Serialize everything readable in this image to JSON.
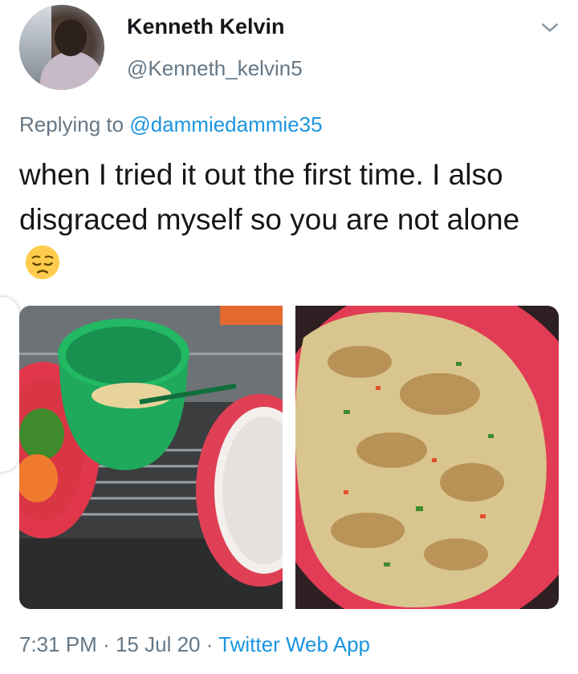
{
  "author": {
    "name": "Kenneth Kelvin",
    "handle": "@Kenneth_kelvin5"
  },
  "reply": {
    "prefix": "Replying to",
    "mention": "@dammiedammie35"
  },
  "tweet": {
    "text": "when I tried it out the first time. I also disgraced myself so you are not alone",
    "emoji": "pensive-face"
  },
  "media": [
    {
      "description_icon": "photo"
    },
    {
      "description_icon": "photo"
    }
  ],
  "footer": {
    "time": "7:31 PM",
    "separator": "·",
    "date": "15 Jul 20",
    "source": "Twitter Web App"
  },
  "colors": {
    "link": "#1b95e0",
    "secondary_text": "#657786",
    "primary_text": "#14171a"
  }
}
